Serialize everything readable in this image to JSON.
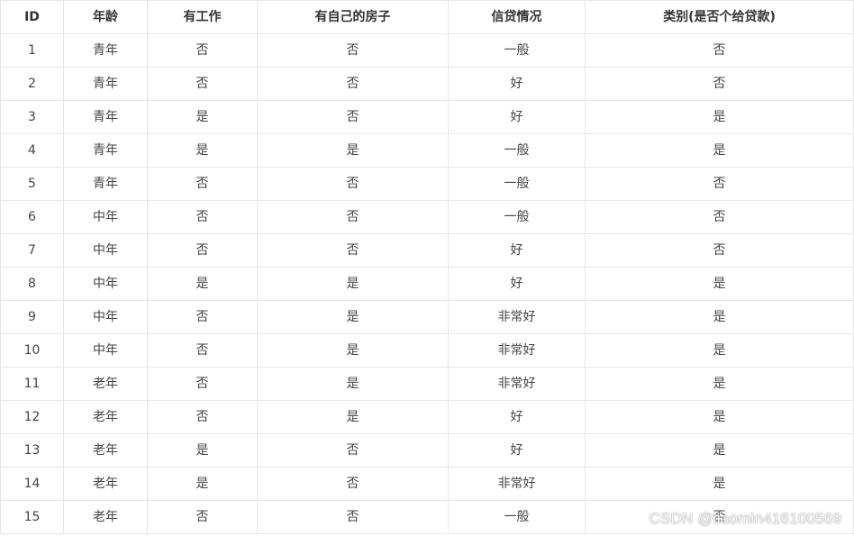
{
  "table": {
    "headers": [
      "ID",
      "年龄",
      "有工作",
      "有自己的房子",
      "信贷情况",
      "类别(是否个给贷款)"
    ],
    "rows": [
      [
        "1",
        "青年",
        "否",
        "否",
        "一般",
        "否"
      ],
      [
        "2",
        "青年",
        "否",
        "否",
        "好",
        "否"
      ],
      [
        "3",
        "青年",
        "是",
        "否",
        "好",
        "是"
      ],
      [
        "4",
        "青年",
        "是",
        "是",
        "一般",
        "是"
      ],
      [
        "5",
        "青年",
        "否",
        "否",
        "一般",
        "否"
      ],
      [
        "6",
        "中年",
        "否",
        "否",
        "一般",
        "否"
      ],
      [
        "7",
        "中年",
        "否",
        "否",
        "好",
        "否"
      ],
      [
        "8",
        "中年",
        "是",
        "是",
        "好",
        "是"
      ],
      [
        "9",
        "中年",
        "否",
        "是",
        "非常好",
        "是"
      ],
      [
        "10",
        "中年",
        "否",
        "是",
        "非常好",
        "是"
      ],
      [
        "11",
        "老年",
        "否",
        "是",
        "非常好",
        "是"
      ],
      [
        "12",
        "老年",
        "否",
        "是",
        "好",
        "是"
      ],
      [
        "13",
        "老年",
        "是",
        "否",
        "好",
        "是"
      ],
      [
        "14",
        "老年",
        "是",
        "否",
        "非常好",
        "是"
      ],
      [
        "15",
        "老年",
        "否",
        "否",
        "一般",
        "否"
      ]
    ]
  },
  "watermark": "CSDN @liaomin416100569"
}
